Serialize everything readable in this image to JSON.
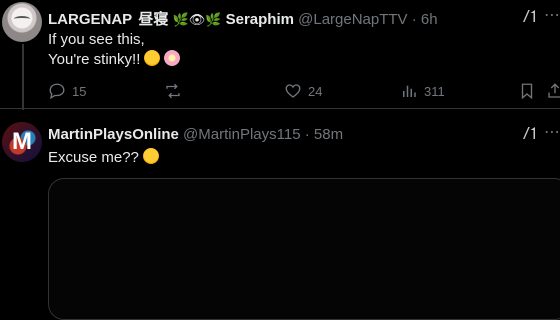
{
  "tweet1": {
    "name": "LARGENAP",
    "decoration": "昼寝",
    "name_suffix": "Seraphim",
    "handle": "@LargeNapTTV",
    "separator": "·",
    "time": "6h",
    "text_line1": "If you see this,",
    "text_line2": "You're stinky!!",
    "replies": "15",
    "likes": "24",
    "views": "311"
  },
  "tweet2": {
    "name": "MartinPlaysOnline",
    "handle": "@MartinPlays115",
    "separator": "·",
    "time": "58m",
    "text": "Excuse me??"
  },
  "icons": {
    "reply": "reply-icon",
    "retweet": "retweet-icon",
    "like": "heart-icon",
    "views": "views-icon",
    "bookmark": "bookmark-icon",
    "share": "share-icon",
    "grok": "grok-icon"
  },
  "colors": {
    "background": "#000000",
    "text": "#e7e9ea",
    "muted": "#71767b",
    "border": "#2f3336"
  }
}
